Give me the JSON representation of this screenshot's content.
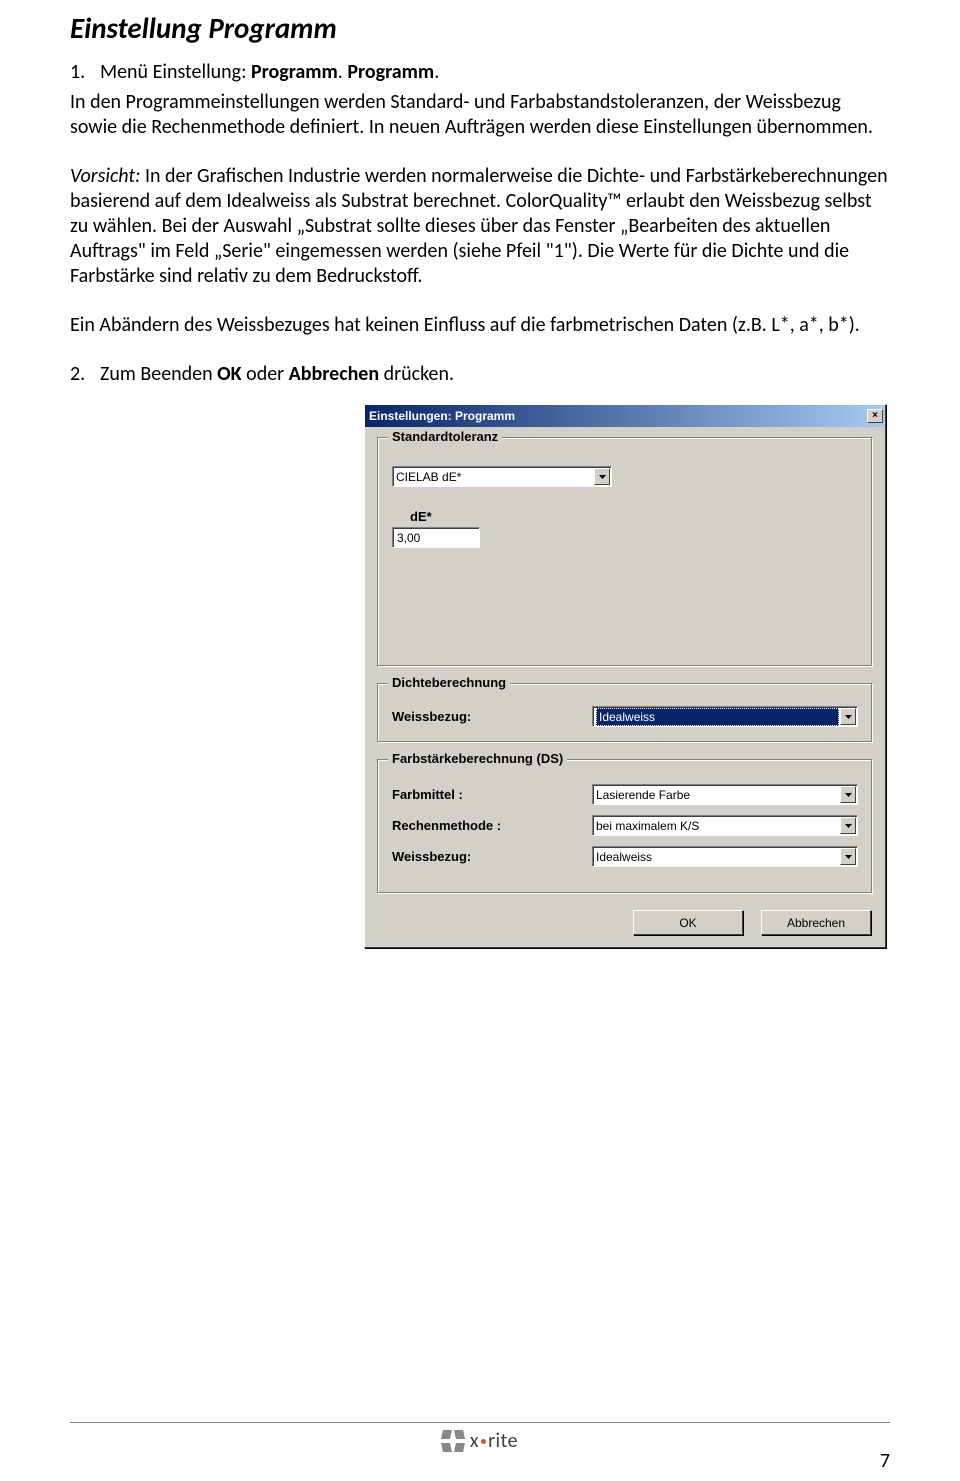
{
  "doc": {
    "heading": "Einstellung Programm",
    "step1_num": "1.",
    "step1_text_a": "Menü Einstellung: ",
    "step1_text_b": "Programm",
    "step1_text_c": ". ",
    "step1_text_d": "Programm",
    "step1_text_e": ".",
    "p1": "In den Programmeinstellungen werden Standard- und Farbabstandstoleranzen, der Weissbezug sowie die Rechenmethode definiert. In neuen Aufträgen werden diese Einstellungen übernommen.",
    "p2_a": "Vorsicht:",
    "p2_b": " In der Grafischen Industrie werden normalerweise die Dichte- und Farbstärkeberechnungen basierend auf dem Idealweiss als Substrat berechnet. ColorQuality™ erlaubt den Weissbezug selbst zu wählen. Bei der Auswahl „Substrat sollte dieses über das Fenster „Bearbeiten des aktuellen Auftrags\" im Feld „Serie\" eingemessen werden (siehe Pfeil \"1\"). Die Werte für die Dichte und die Farbstärke sind relativ zu dem Bedruckstoff.",
    "p3": "Ein Abändern des Weissbezuges hat keinen Einfluss auf die farbmetrischen Daten (z.B. L*, a*, b*).",
    "step2_num": "2.",
    "step2_a": "Zum Beenden ",
    "step2_b": "OK",
    "step2_c": " oder ",
    "step2_d": "Abbrechen",
    "step2_e": " drücken."
  },
  "dialog": {
    "title": "Einstellungen: Programm",
    "close": "×",
    "group_std": "Standardtoleranz",
    "std_select": "CIELAB dE*",
    "de_label": "dE*",
    "de_value": "3,00",
    "group_dichte": "Dichteberechnung",
    "dichte_label": "Weissbezug:",
    "dichte_value": "Idealweiss",
    "group_farb": "Farbstärkeberechnung (DS)",
    "farbmittel_label": "Farbmittel :",
    "farbmittel_value": "Lasierende Farbe",
    "rechen_label": "Rechenmethode :",
    "rechen_value": "bei maximalem K/S",
    "weiss_label": "Weissbezug:",
    "weiss_value": "Idealweiss",
    "ok": "OK",
    "cancel": "Abbrechen"
  },
  "footer": {
    "brand_a": "x",
    "brand_b": "rite",
    "page": "7"
  }
}
